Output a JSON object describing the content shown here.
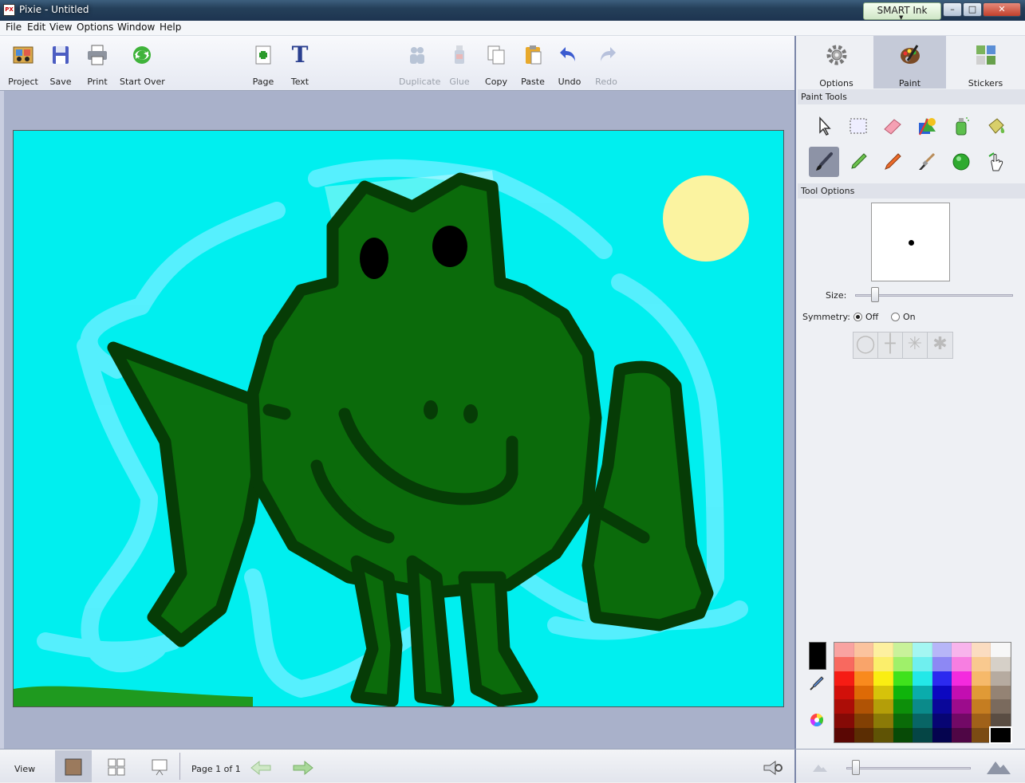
{
  "window": {
    "title": "Pixie - Untitled",
    "app_icon": "pixie-app-icon",
    "smart_ink": "SMART Ink",
    "minimize": "–",
    "maximize": "□",
    "close": "✕"
  },
  "menu": [
    "File",
    "Edit",
    "View",
    "Options",
    "Window",
    "Help"
  ],
  "toolbar": {
    "project": "Project",
    "save": "Save",
    "print": "Print",
    "start_over": "Start Over",
    "page": "Page",
    "text": "Text",
    "text_glyph": "T",
    "duplicate": "Duplicate",
    "glue": "Glue",
    "copy": "Copy",
    "paste": "Paste",
    "undo": "Undo",
    "redo": "Redo"
  },
  "panel": {
    "tabs": [
      "Options",
      "Paint",
      "Stickers"
    ],
    "active_tab": "Paint",
    "paint_tools_heading": "Paint Tools",
    "tool_icons": [
      "select-arrow-icon",
      "marquee-select-icon",
      "eraser-icon",
      "fill-shapes-icon",
      "spray-can-icon",
      "paint-bucket-icon",
      "brush-icon",
      "marker-icon",
      "crayon-icon",
      "paintbrush-icon",
      "ball-icon",
      "smudge-hand-icon"
    ],
    "selected_tool": "brush-icon",
    "tool_options_heading": "Tool Options",
    "size_label": "Size:",
    "size_value": 0.12,
    "symmetry_label": "Symmetry:",
    "symmetry_off": "Off",
    "symmetry_on": "On",
    "symmetry_selected": "Off",
    "current_color": "#000000",
    "palette": [
      "#f9a3a1",
      "#fbc39e",
      "#fdf09f",
      "#c9f29a",
      "#a4f6f2",
      "#b7b6f8",
      "#f8b4ec",
      "#fbdcc0",
      "#f7f7f7",
      "#f8695f",
      "#f9a46a",
      "#fbee6b",
      "#9ff06a",
      "#6fefef",
      "#8d88f4",
      "#f77ee1",
      "#f9c98f",
      "#d6d0c8",
      "#f61c14",
      "#f98a1d",
      "#faee12",
      "#3fe21c",
      "#23e8e8",
      "#2c2aef",
      "#f42ade",
      "#f6b96a",
      "#b6aba0",
      "#d2100a",
      "#dd6a06",
      "#d6c30a",
      "#0fb40b",
      "#0aacac",
      "#0c08c0",
      "#c30eb1",
      "#e09a36",
      "#948374",
      "#ac0d07",
      "#b05305",
      "#b49e09",
      "#0d8f0a",
      "#0b8a8a",
      "#0a0799",
      "#9c0c8c",
      "#c57d21",
      "#7a6a5d",
      "#850a06",
      "#824004",
      "#8b7a07",
      "#0a6b08",
      "#086565",
      "#070573",
      "#720966",
      "#a06119",
      "#5a4d43",
      "#5a0704",
      "#5b2d03",
      "#5f5305",
      "#074a06",
      "#054545",
      "#05044f",
      "#4f0645",
      "#7b4b13",
      "#000000"
    ]
  },
  "status": {
    "view": "View",
    "page_indicator": "Page 1 of 1",
    "zoom": 0.05
  }
}
